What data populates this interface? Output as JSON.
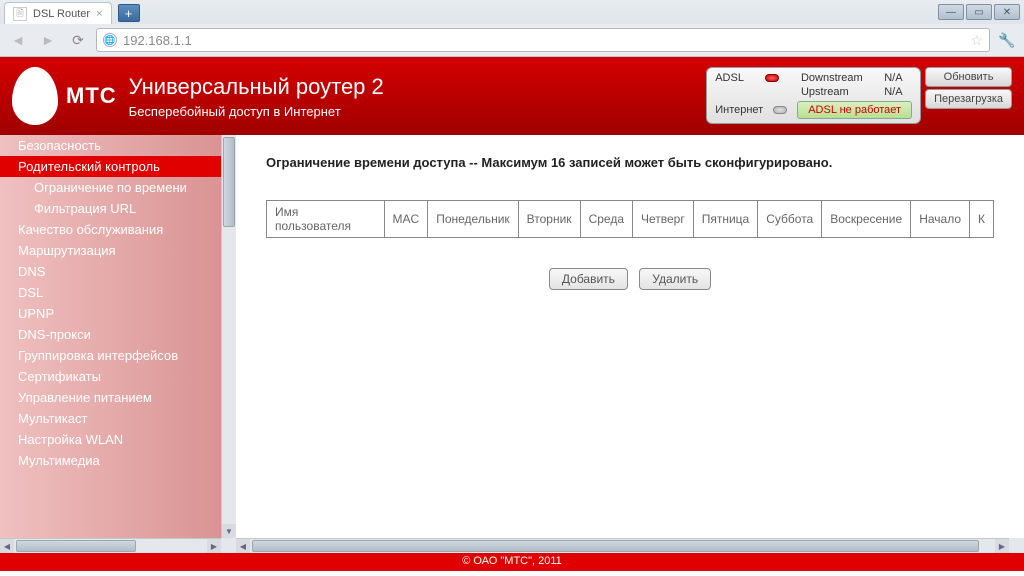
{
  "browser": {
    "tab_title": "DSL Router",
    "url": "192.168.1.1"
  },
  "header": {
    "brand": "МТС",
    "title": "Универсальный роутер 2",
    "subtitle": "Бесперебойный доступ в Интернет"
  },
  "status": {
    "adsl_label": "ADSL",
    "downstream_label": "Downstream",
    "upstream_label": "Upstream",
    "downstream_val": "N/A",
    "upstream_val": "N/A",
    "internet_label": "Интернет",
    "adsl_error": "ADSL не работает",
    "refresh": "Обновить",
    "reboot": "Перезагрузка"
  },
  "sidebar": {
    "items": [
      {
        "label": "Безопасность",
        "sub": false,
        "active": false
      },
      {
        "label": "Родительский контроль",
        "sub": false,
        "active": true
      },
      {
        "label": "Ограничение по времени",
        "sub": true,
        "active": false
      },
      {
        "label": "Фильтрация URL",
        "sub": true,
        "active": false
      },
      {
        "label": "Качество обслуживания",
        "sub": false,
        "active": false
      },
      {
        "label": "Маршрутизация",
        "sub": false,
        "active": false
      },
      {
        "label": "DNS",
        "sub": false,
        "active": false
      },
      {
        "label": "DSL",
        "sub": false,
        "active": false
      },
      {
        "label": "UPNP",
        "sub": false,
        "active": false
      },
      {
        "label": "DNS-прокси",
        "sub": false,
        "active": false
      },
      {
        "label": "Группировка интерфейсов",
        "sub": false,
        "active": false
      },
      {
        "label": "Сертификаты",
        "sub": false,
        "active": false
      },
      {
        "label": "Управление питанием",
        "sub": false,
        "active": false
      },
      {
        "label": "Мультикаст",
        "sub": false,
        "active": false
      },
      {
        "label": "Настройка WLAN",
        "sub": false,
        "active": false
      },
      {
        "label": "Мультимедиа",
        "sub": false,
        "active": false
      }
    ]
  },
  "content": {
    "heading": "Ограничение времени доступа -- Максимум 16 записей может быть сконфигурировано.",
    "columns": [
      "Имя пользователя",
      "MAC",
      "Понедельник",
      "Вторник",
      "Среда",
      "Четверг",
      "Пятница",
      "Суббота",
      "Воскресение",
      "Начало",
      "К"
    ],
    "add": "Добавить",
    "remove": "Удалить"
  },
  "footer": "© ОАО \"МТС\", 2011"
}
